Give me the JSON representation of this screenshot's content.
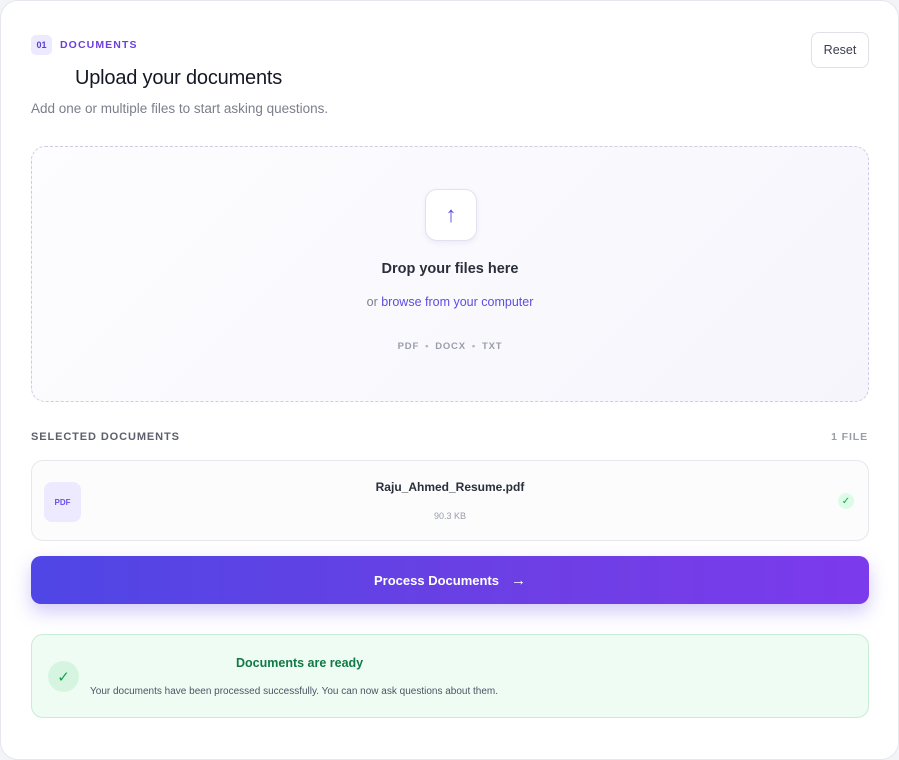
{
  "colors": {
    "accent": "#5b4ee0",
    "accent_purple": "#7c3aed",
    "success": "#16a34a",
    "success_bg": "#effcf4"
  },
  "header": {
    "step_number": "01",
    "step_label": "DOCUMENTS",
    "title": "Upload your documents",
    "subtitle": "Add one or multiple files to start asking questions.",
    "reset_label": "Reset"
  },
  "dropzone": {
    "icon": "upload-arrow-icon",
    "icon_glyph": "↑",
    "title": "Drop your files here",
    "or_text": "or",
    "browse_label": "browse from your computer",
    "formats": [
      "PDF",
      "DOCX",
      "TXT"
    ],
    "separator": "•"
  },
  "selected": {
    "label": "SELECTED DOCUMENTS",
    "count": "1 FILE",
    "files": [
      {
        "type_badge": "PDF",
        "name": "Raju_Ahmed_Resume.pdf",
        "size": "90.3 KB",
        "status_icon": "check-icon",
        "status_glyph": "✓"
      }
    ]
  },
  "action": {
    "process_label": "Process Documents",
    "arrow_glyph": "→"
  },
  "status": {
    "icon": "check-circle-icon",
    "icon_glyph": "✓",
    "title": "Documents are ready",
    "message": "Your documents have been processed successfully. You can now ask questions about them."
  }
}
